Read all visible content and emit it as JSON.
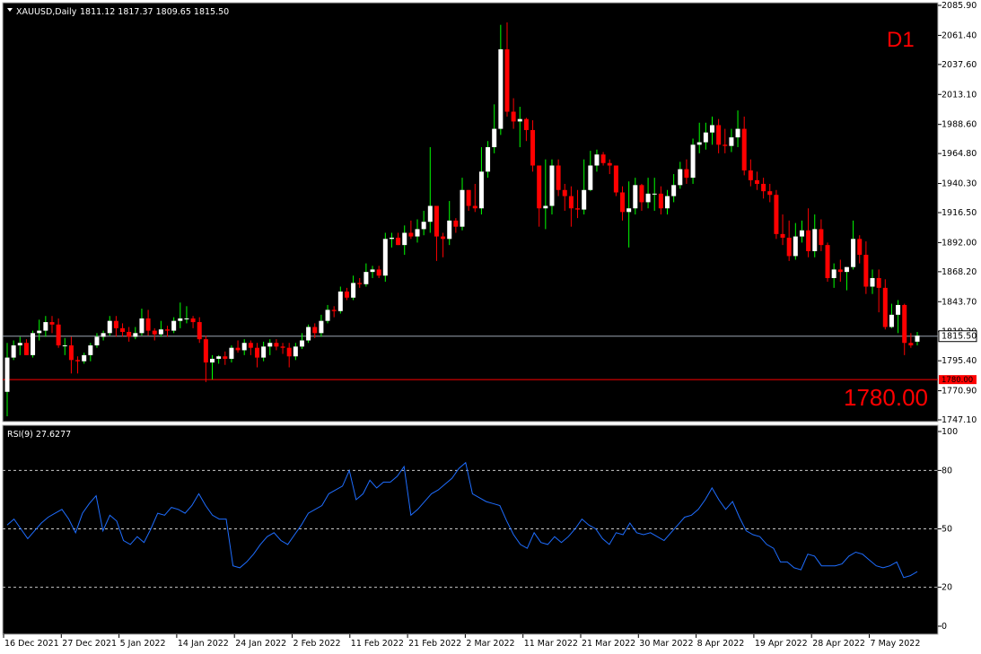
{
  "header": {
    "symbol": "XAUUSD,Daily",
    "ohlc": "1811.12 1817.37 1809.65 1815.50",
    "timeframe_label": "D1",
    "level_label": "1780.00"
  },
  "price_axis": {
    "ticks": [
      "2085.90",
      "2061.40",
      "2037.60",
      "2013.10",
      "1988.60",
      "1964.80",
      "1940.30",
      "1916.50",
      "1892.00",
      "1868.20",
      "1843.70",
      "1819.20",
      "1795.40",
      "1770.90",
      "1747.10"
    ],
    "current_price_label": "1815.50",
    "level_price_label": "1780.00"
  },
  "rsi": {
    "header": "RSI(9) 27.6277",
    "ticks": [
      "100",
      "80",
      "50",
      "20",
      "0"
    ],
    "levels": [
      80,
      50,
      20
    ]
  },
  "time_axis": {
    "labels": [
      "16 Dec 2021",
      "27 Dec 2021",
      "5 Jan 2022",
      "14 Jan 2022",
      "24 Jan 2022",
      "2 Feb 2022",
      "11 Feb 2022",
      "21 Feb 2022",
      "2 Mar 2022",
      "11 Mar 2022",
      "21 Mar 2022",
      "30 Mar 2022",
      "8 Apr 2022",
      "19 Apr 2022",
      "28 Apr 2022",
      "7 May 2022"
    ]
  },
  "colors": {
    "background": "#000000",
    "up_candle": "#ffffff",
    "up_wick": "#00ff00",
    "down_candle": "#ff0000",
    "rsi_line": "#1e6dff",
    "level_line": "#ff0000",
    "bid_line": "#9aa3b0"
  },
  "chart_data": [
    {
      "type": "candlestick",
      "title": "XAUUSD,Daily",
      "x": [
        "16 Dec 2021",
        "27 Dec 2021",
        "5 Jan 2022",
        "14 Jan 2022",
        "24 Jan 2022",
        "2 Feb 2022",
        "11 Feb 2022",
        "21 Feb 2022",
        "2 Mar 2022",
        "11 Mar 2022",
        "21 Mar 2022",
        "30 Mar 2022",
        "8 Apr 2022",
        "19 Apr 2022",
        "28 Apr 2022",
        "7 May 2022"
      ],
      "close": [
        1798,
        1808,
        1810,
        1800,
        1818,
        1820,
        1827,
        1825,
        1808,
        1808,
        1796,
        1795,
        1800,
        1808,
        1815,
        1818,
        1828,
        1822,
        1819,
        1815,
        1818,
        1830,
        1820,
        1817,
        1821,
        1820,
        1828,
        1830,
        1830,
        1827,
        1813,
        1794,
        1797,
        1799,
        1797,
        1806,
        1804,
        1810,
        1806,
        1798,
        1807,
        1810,
        1807,
        1806,
        1799,
        1807,
        1812,
        1823,
        1818,
        1828,
        1837,
        1836,
        1852,
        1847,
        1859,
        1858,
        1868,
        1870,
        1865,
        1895,
        1896,
        1890,
        1900,
        1897,
        1903,
        1909,
        1922,
        1897,
        1895,
        1910,
        1905,
        1935,
        1922,
        1920,
        1950,
        1970,
        1985,
        2050,
        1999,
        1991,
        1993,
        1984,
        1955,
        1920,
        1922,
        1955,
        1935,
        1930,
        1920,
        1919,
        1935,
        1955,
        1964,
        1957,
        1955,
        1933,
        1917,
        1920,
        1939,
        1925,
        1932,
        1932,
        1920,
        1930,
        1939,
        1952,
        1945,
        1972,
        1974,
        1982,
        1988,
        1972,
        1971,
        1978,
        1985,
        1951,
        1943,
        1940,
        1934,
        1931,
        1899,
        1896,
        1881,
        1897,
        1902,
        1885,
        1903,
        1890,
        1863,
        1870,
        1868,
        1872,
        1895,
        1882,
        1856,
        1863,
        1855,
        1823,
        1833,
        1841,
        1810,
        1808,
        1816
      ],
      "open": [
        1770,
        1798,
        1808,
        1810,
        1800,
        1818,
        1820,
        1827,
        1825,
        1808,
        1808,
        1796,
        1795,
        1800,
        1808,
        1815,
        1818,
        1828,
        1822,
        1819,
        1815,
        1818,
        1830,
        1820,
        1817,
        1821,
        1820,
        1828,
        1830,
        1830,
        1827,
        1813,
        1794,
        1797,
        1799,
        1797,
        1806,
        1804,
        1810,
        1806,
        1798,
        1807,
        1810,
        1807,
        1806,
        1799,
        1807,
        1812,
        1823,
        1818,
        1828,
        1837,
        1836,
        1852,
        1847,
        1859,
        1858,
        1868,
        1870,
        1865,
        1895,
        1896,
        1890,
        1900,
        1897,
        1903,
        1909,
        1922,
        1897,
        1895,
        1910,
        1905,
        1935,
        1922,
        1920,
        1950,
        1970,
        1985,
        2050,
        1999,
        1991,
        1993,
        1984,
        1955,
        1920,
        1922,
        1955,
        1935,
        1930,
        1920,
        1919,
        1935,
        1955,
        1964,
        1957,
        1955,
        1933,
        1917,
        1920,
        1939,
        1925,
        1932,
        1932,
        1920,
        1930,
        1939,
        1952,
        1945,
        1972,
        1974,
        1982,
        1988,
        1972,
        1971,
        1978,
        1985,
        1951,
        1943,
        1940,
        1934,
        1931,
        1899,
        1896,
        1881,
        1897,
        1902,
        1885,
        1903,
        1890,
        1863,
        1870,
        1868,
        1872,
        1895,
        1882,
        1856,
        1863,
        1855,
        1823,
        1833,
        1841,
        1810,
        1811
      ],
      "high": [
        1810,
        1812,
        1815,
        1813,
        1820,
        1829,
        1832,
        1832,
        1830,
        1814,
        1815,
        1799,
        1802,
        1810,
        1818,
        1820,
        1832,
        1832,
        1826,
        1823,
        1823,
        1838,
        1837,
        1822,
        1828,
        1824,
        1831,
        1843,
        1840,
        1832,
        1831,
        1816,
        1800,
        1800,
        1803,
        1808,
        1812,
        1813,
        1812,
        1810,
        1811,
        1813,
        1813,
        1810,
        1810,
        1810,
        1818,
        1825,
        1826,
        1833,
        1841,
        1840,
        1856,
        1855,
        1865,
        1863,
        1875,
        1873,
        1873,
        1900,
        1900,
        1900,
        1906,
        1910,
        1911,
        1918,
        1970,
        1900,
        1900,
        1926,
        1912,
        1945,
        1935,
        1940,
        1970,
        1975,
        2005,
        2070,
        2072,
        2010,
        2003,
        1994,
        1992,
        1930,
        1960,
        1960,
        1960,
        1940,
        1938,
        1935,
        1960,
        1967,
        1968,
        1966,
        1960,
        1955,
        1938,
        1942,
        1945,
        1940,
        1945,
        1945,
        1938,
        1935,
        1948,
        1958,
        1960,
        1977,
        1990,
        1990,
        1995,
        1993,
        1985,
        1985,
        2000,
        1995,
        1960,
        1950,
        1945,
        1940,
        1935,
        1915,
        1910,
        1908,
        1910,
        1920,
        1915,
        1911,
        1892,
        1875,
        1878,
        1872,
        1910,
        1898,
        1893,
        1870,
        1870,
        1862,
        1842,
        1845,
        1842,
        1818,
        1819
      ],
      "low": [
        1750,
        1796,
        1800,
        1800,
        1798,
        1812,
        1815,
        1818,
        1806,
        1800,
        1785,
        1785,
        1793,
        1795,
        1806,
        1812,
        1816,
        1815,
        1815,
        1811,
        1813,
        1816,
        1816,
        1812,
        1815,
        1815,
        1818,
        1822,
        1826,
        1822,
        1810,
        1778,
        1780,
        1793,
        1792,
        1794,
        1802,
        1800,
        1800,
        1790,
        1795,
        1800,
        1804,
        1801,
        1790,
        1796,
        1805,
        1810,
        1814,
        1815,
        1826,
        1831,
        1834,
        1845,
        1845,
        1855,
        1856,
        1863,
        1863,
        1860,
        1888,
        1890,
        1882,
        1895,
        1892,
        1898,
        1900,
        1877,
        1880,
        1890,
        1900,
        1902,
        1918,
        1917,
        1915,
        1945,
        1965,
        1980,
        1995,
        1985,
        1970,
        1975,
        1950,
        1905,
        1903,
        1915,
        1930,
        1918,
        1905,
        1912,
        1915,
        1934,
        1950,
        1955,
        1948,
        1930,
        1910,
        1888,
        1915,
        1918,
        1920,
        1918,
        1915,
        1915,
        1925,
        1936,
        1940,
        1940,
        1965,
        1968,
        1972,
        1965,
        1965,
        1966,
        1970,
        1947,
        1938,
        1935,
        1928,
        1925,
        1895,
        1890,
        1877,
        1878,
        1892,
        1880,
        1880,
        1885,
        1860,
        1855,
        1860,
        1853,
        1870,
        1875,
        1850,
        1850,
        1835,
        1821,
        1822,
        1818,
        1800,
        1806,
        1808
      ]
    },
    {
      "type": "line",
      "title": "RSI(9) 27.6277",
      "ylim": [
        0,
        100
      ],
      "values": [
        52,
        55,
        50,
        45,
        49,
        53,
        56,
        58,
        60,
        55,
        48,
        58,
        63,
        67,
        49,
        57,
        54,
        44,
        42,
        46,
        43,
        50,
        58,
        57,
        61,
        60,
        58,
        62,
        68,
        62,
        57,
        55,
        55,
        31,
        30,
        33,
        37,
        42,
        46,
        48,
        44,
        42,
        47,
        52,
        58,
        60,
        62,
        68,
        70,
        72,
        80,
        65,
        68,
        75,
        71,
        74,
        74,
        77,
        82,
        57,
        60,
        64,
        68,
        70,
        73,
        76,
        81,
        84,
        68,
        66,
        64,
        63,
        62,
        54,
        47,
        42,
        40,
        48,
        43,
        42,
        46,
        43,
        46,
        50,
        55,
        52,
        50,
        45,
        42,
        48,
        47,
        53,
        48,
        47,
        48,
        46,
        44,
        48,
        52,
        56,
        57,
        60,
        65,
        71,
        65,
        60,
        64,
        56,
        49,
        47,
        46,
        42,
        40,
        33,
        33,
        30,
        29,
        37,
        36,
        31,
        31,
        31,
        32,
        36,
        38,
        37,
        34,
        31,
        30,
        31,
        33,
        25,
        26,
        28
      ],
      "levels": [
        80,
        50,
        20
      ]
    }
  ]
}
